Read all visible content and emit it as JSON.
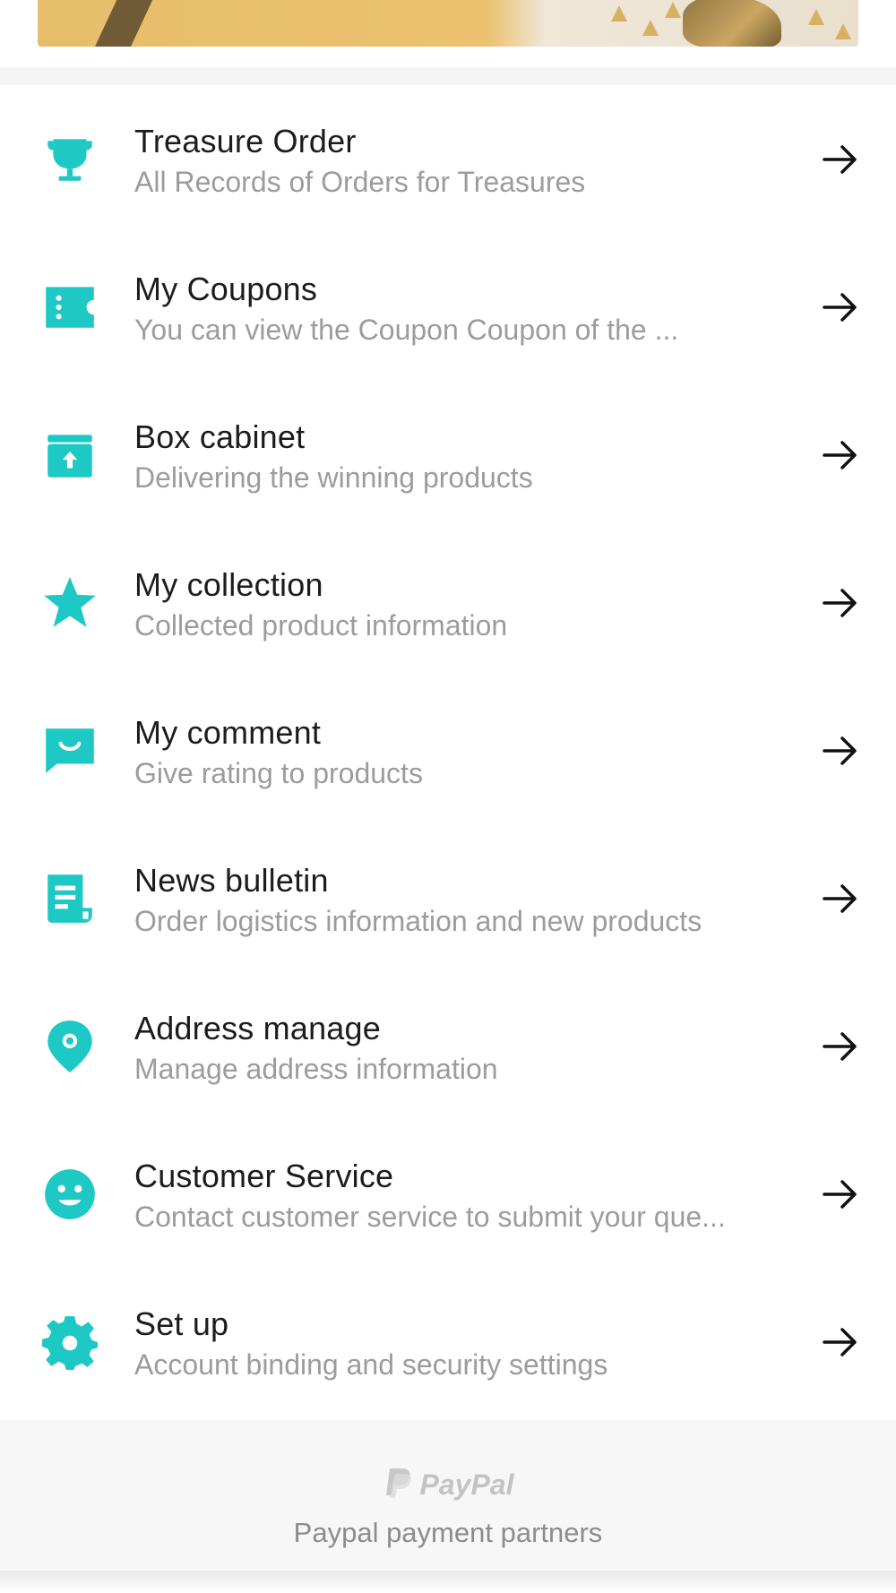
{
  "theme": {
    "accent": "#1ec8c4",
    "title_color": "#1c1c1c",
    "subtitle_color": "#9c9c9c"
  },
  "menu": {
    "items": [
      {
        "icon": "trophy-icon",
        "title": "Treasure Order",
        "subtitle": "All Records of Orders for Treasures"
      },
      {
        "icon": "coupon-icon",
        "title": "My Coupons",
        "subtitle": "You can view the Coupon Coupon of the ..."
      },
      {
        "icon": "box-icon",
        "title": "Box cabinet",
        "subtitle": "Delivering the winning products"
      },
      {
        "icon": "star-icon",
        "title": "My collection",
        "subtitle": "Collected product information"
      },
      {
        "icon": "comment-icon",
        "title": "My comment",
        "subtitle": "Give rating to products"
      },
      {
        "icon": "news-icon",
        "title": "News bulletin",
        "subtitle": "Order logistics information and new products"
      },
      {
        "icon": "location-pin-icon",
        "title": "Address manage",
        "subtitle": "Manage address information"
      },
      {
        "icon": "smiley-icon",
        "title": "Customer Service",
        "subtitle": "Contact customer service to submit your que..."
      },
      {
        "icon": "gear-icon",
        "title": "Set up",
        "subtitle": "Account binding and security settings"
      }
    ]
  },
  "footer": {
    "logo_text": "PayPal",
    "caption": "Paypal payment partners"
  }
}
